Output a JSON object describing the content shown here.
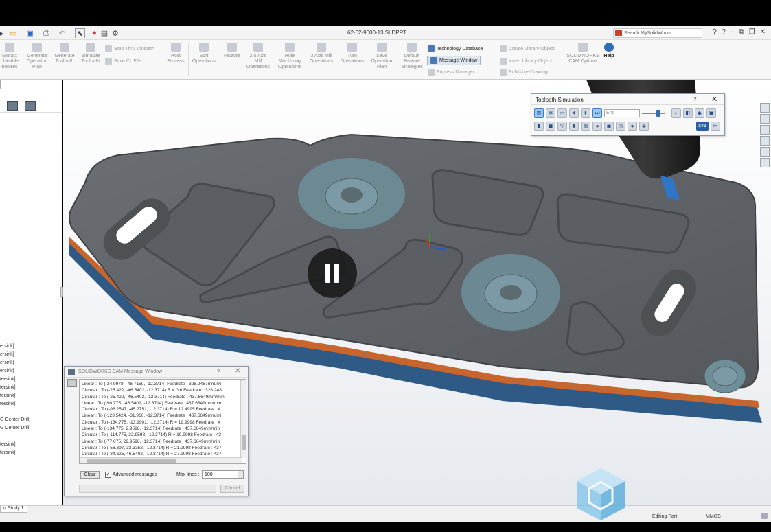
{
  "window": {
    "document_title": "62-02-9000-13.SLDPRT",
    "search_placeholder": "Search MySolidWorks"
  },
  "ribbon": {
    "extract": [
      "Extract",
      "chinable",
      "eatures"
    ],
    "generate_plan": [
      "Generate",
      "Operation",
      "Plan"
    ],
    "generate_toolpath": [
      "Generate",
      "Toolpath"
    ],
    "simulate_toolpath": [
      "Simulate",
      "Toolpath"
    ],
    "step_thru": "Step Thru Toolpath",
    "save_cl": "Save CL File",
    "post_process": [
      "Post",
      "Process"
    ],
    "sort_operations": [
      "Sort",
      "Operations"
    ],
    "feature": "Feature",
    "mill_25": [
      "2.5 Axis",
      "Mill",
      "Operations"
    ],
    "hole_machining": [
      "Hole",
      "Machining",
      "Operations"
    ],
    "mill_3": [
      "3 Axis Mill",
      "Operations"
    ],
    "turn_operations": [
      "Turn",
      "Operations"
    ],
    "save_plan": [
      "Save",
      "Operation",
      "Plan"
    ],
    "default_strategies": [
      "Default",
      "Feature",
      "Strategies"
    ],
    "technology_database": "Technology Database",
    "message_window": "Message Window",
    "process_manager": "Process Manager",
    "create_library": "Create Library Object",
    "insert_library": "Insert Library Object",
    "publish_edrawing": "Publish e-Drawing",
    "cam_options": [
      "SOLIDWORKS",
      "CAM Options"
    ],
    "help": "Help"
  },
  "left_panel": {
    "tree_items": [
      "ersink]",
      "ersink]",
      "ersink]",
      "ersink]",
      "tersink]",
      "tersink]",
      "tersink]",
      "tersink]",
      "G Center Drill]",
      "G Center Drill]",
      "tersink]",
      "tersink]"
    ]
  },
  "toolpath_simulation": {
    "title": "Toolpath Simulation",
    "help_glyph": "?",
    "close_glyph": "✕",
    "end_field": "End",
    "xyz_label": "XYZ"
  },
  "message_window": {
    "title": "SOLIDWORKS CAM Message Window",
    "help_glyph": "?",
    "close_glyph": "✕",
    "lines": [
      "Linear : To (-24.9978, -46.7159, -12.3714) Feedrate : 328.2487mm/mi",
      "Circular : To (-25.422, -46.5402, -12.3714) R = 0.6 Feedrate : 328.248",
      "Circular : To (-25.422, -46.5402, -12.3714) Feedrate : 437.6649mm/min",
      "Linear : To (-90.775, -46.5402, -12.3714) Feedrate : 437.6649mm/min",
      "Circular : To (-96.2547, -45.2751, -12.3714) R = 12.4995 Feedrate : 4",
      "Linear : To (-123.5424, -31.966, -12.3714) Feedrate : 437.6649mm/mi",
      "Circular : To (-134.775, -13.9901, -12.3714) R = 19.9998 Feedrate : 4",
      "Linear : To (-134.775, 2.9598, -12.3714) Feedrate : 437.6649mm/min",
      "Circular : To (-114.775, 22.9598, -12.3714) R = 19.9998 Feedrate : 43",
      "Linear : To (-77.075, 22.9598, -12.3714) Feedrate : 437.6649mm/min",
      "Circular : To (-58.397, 33.3352, -12.3714) R = 21.9998 Feedrate : 437",
      "Circular : To (-34.625, 46.5402, -12.3714) R = 27.9998 Feedrate : 437"
    ],
    "clear_label": "Clear",
    "advanced_label": "Advanced messages",
    "advanced_checked": "✓",
    "max_lines_label": "Max lines :",
    "max_lines_value": "100",
    "cancel_label": "Cancel"
  },
  "status_bar": {
    "tab": "n Study 1",
    "mode": "Editing Part",
    "units": "MMGS"
  },
  "colors": {
    "part_body": "#5f6266",
    "part_top": "#6d7075",
    "face_highlight": "#7c9aa6",
    "orange_layer": "#c8652c",
    "blue_layer": "#2f5a86",
    "accent": "#2f6db5"
  }
}
